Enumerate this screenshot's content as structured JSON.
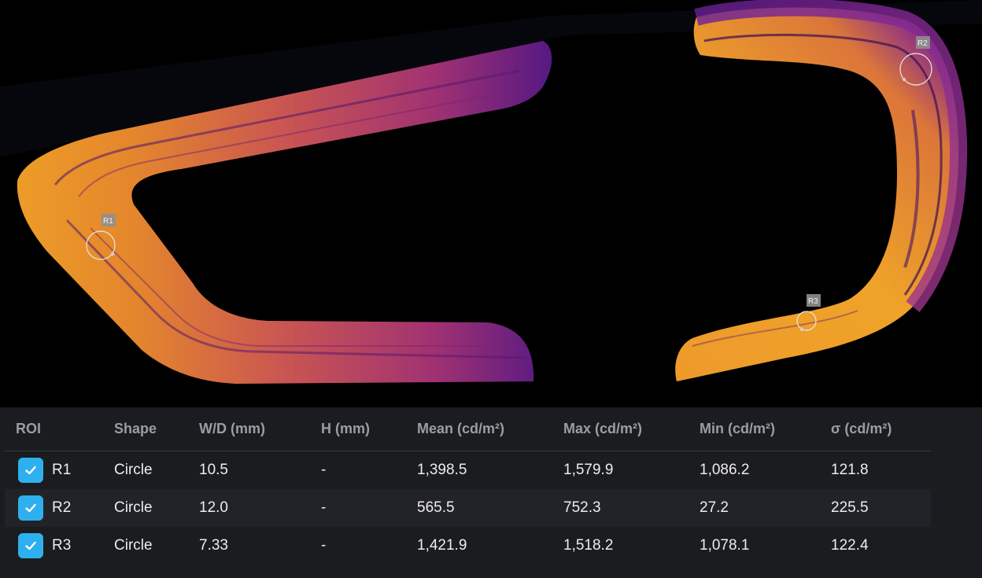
{
  "viewer": {
    "rois": [
      {
        "tag": "R1"
      },
      {
        "tag": "R2"
      },
      {
        "tag": "R3"
      }
    ]
  },
  "table": {
    "headers": {
      "roi": "ROI",
      "shape": "Shape",
      "wd": "W/D (mm)",
      "h": "H (mm)",
      "mean": "Mean (cd/m²)",
      "max": "Max (cd/m²)",
      "min": "Min (cd/m²)",
      "sigma": "σ (cd/m²)"
    },
    "rows": [
      {
        "checked": true,
        "name": "R1",
        "shape": "Circle",
        "wd": "10.5",
        "h": "-",
        "mean": "1,398.5",
        "max": "1,579.9",
        "min": "1,086.2",
        "sigma": "121.8"
      },
      {
        "checked": true,
        "name": "R2",
        "shape": "Circle",
        "wd": "12.0",
        "h": "-",
        "mean": "565.5",
        "max": "752.3",
        "min": "27.2",
        "sigma": "225.5"
      },
      {
        "checked": true,
        "name": "R3",
        "shape": "Circle",
        "wd": "7.33",
        "h": "-",
        "mean": "1,421.9",
        "max": "1,518.2",
        "min": "1,078.1",
        "sigma": "122.4"
      }
    ]
  },
  "colors": {
    "checkbox": "#2fb0ee",
    "panel_bg": "#1b1c1f",
    "row_alt_bg": "#222328",
    "header_text": "#9a9da4",
    "heatmap_hot": "#f7a52a",
    "heatmap_cool": "#7a1fa0"
  }
}
